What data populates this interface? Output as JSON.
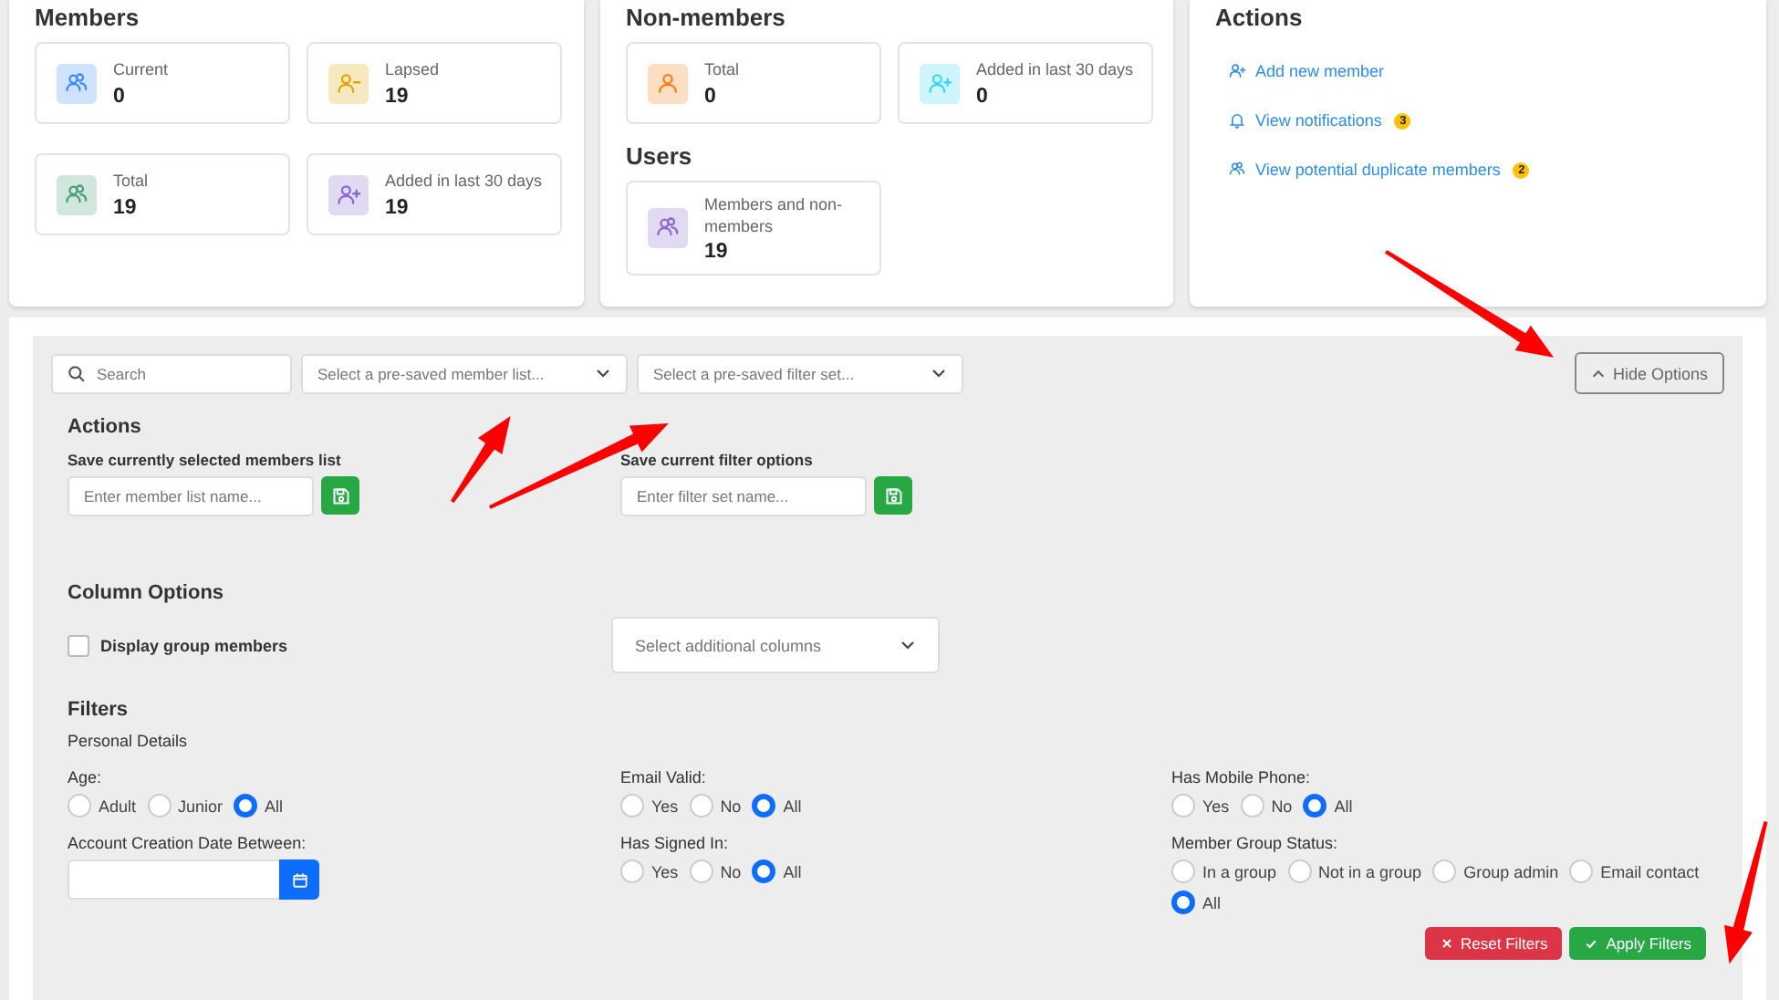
{
  "members": {
    "title": "Members",
    "stats": [
      {
        "label": "Current",
        "value": "0",
        "kind": "group",
        "color": "#3d8bfd"
      },
      {
        "label": "Lapsed",
        "value": "19",
        "kind": "person-minus",
        "color": "#e0a800"
      },
      {
        "label": "Total",
        "value": "19",
        "kind": "group",
        "color": "#479f76"
      },
      {
        "label": "Added in last 30 days",
        "value": "19",
        "kind": "person-add",
        "color": "#8c68cd"
      }
    ]
  },
  "non_members": {
    "title": "Non-members",
    "stats": [
      {
        "label": "Total",
        "value": "0",
        "kind": "person",
        "color": "#fd7e14"
      },
      {
        "label": "Added in last 30 days",
        "value": "0",
        "kind": "person-add",
        "color": "#3dd5f3"
      }
    ]
  },
  "users": {
    "title": "Users",
    "stats": [
      {
        "label": "Members and non-members",
        "value": "19",
        "kind": "group",
        "color": "#8c68cd"
      }
    ]
  },
  "actions": {
    "title": "Actions",
    "links": [
      {
        "label": "Add new member",
        "kind": "person-add"
      },
      {
        "label": "View notifications",
        "kind": "bell",
        "badge": "3"
      },
      {
        "label": "View potential duplicate members",
        "kind": "group",
        "badge": "2"
      }
    ]
  },
  "options": {
    "search": {
      "placeholder": "Search"
    },
    "member_list_select": {
      "placeholder": "Select a pre-saved member list..."
    },
    "filter_set_select": {
      "placeholder": "Select a pre-saved filter set..."
    },
    "hide_button": "Hide Options",
    "actions_title": "Actions",
    "save_fields": [
      {
        "label": "Save currently selected members list",
        "placeholder": "Enter member list name..."
      },
      {
        "label": "Save current filter options",
        "placeholder": "Enter filter set name..."
      }
    ],
    "column_options": {
      "title": "Column Options",
      "checkbox": {
        "label": "Display group members",
        "checked": false
      },
      "columns_select": {
        "placeholder": "Select additional columns"
      }
    },
    "filters": {
      "title": "Filters",
      "subtitle": "Personal Details",
      "groups": [
        {
          "label": "Age:",
          "kind": "radio",
          "options": [
            {
              "label": "Adult",
              "selected": false
            },
            {
              "label": "Junior",
              "selected": false
            },
            {
              "label": "All",
              "selected": true
            }
          ]
        },
        {
          "label": "Email Valid:",
          "kind": "radio",
          "options": [
            {
              "label": "Yes",
              "selected": false
            },
            {
              "label": "No",
              "selected": false
            },
            {
              "label": "All",
              "selected": true
            }
          ]
        },
        {
          "label": "Has Mobile Phone:",
          "kind": "radio",
          "options": [
            {
              "label": "Yes",
              "selected": false
            },
            {
              "label": "No",
              "selected": false
            },
            {
              "label": "All",
              "selected": true
            }
          ]
        },
        {
          "label": "Account Creation Date Between:",
          "kind": "date"
        },
        {
          "label": "Has Signed In:",
          "kind": "radio",
          "options": [
            {
              "label": "Yes",
              "selected": false
            },
            {
              "label": "No",
              "selected": false
            },
            {
              "label": "All",
              "selected": true
            }
          ]
        },
        {
          "label": "Member Group Status:",
          "kind": "radio",
          "options": [
            {
              "label": "In a group",
              "selected": false
            },
            {
              "label": "Not in a group",
              "selected": false
            },
            {
              "label": "Group admin",
              "selected": false
            },
            {
              "label": "Email contact",
              "selected": false
            },
            {
              "label": "All",
              "selected": true
            }
          ]
        }
      ]
    },
    "buttons": [
      {
        "label": "Reset Filters",
        "kind": "reset"
      },
      {
        "label": "Apply Filters",
        "kind": "apply"
      }
    ]
  }
}
